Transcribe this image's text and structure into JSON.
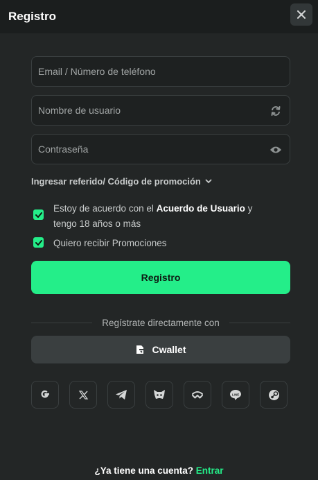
{
  "header": {
    "title": "Registro"
  },
  "form": {
    "email_placeholder": "Email / Número de teléfono",
    "username_placeholder": "Nombre de usuario",
    "password_placeholder": "Contraseña",
    "referral_label": "Ingresar referido/ Código de promoción"
  },
  "agreements": {
    "terms_prefix": "Estoy de acuerdo con el ",
    "terms_link": "Acuerdo de Usuario",
    "terms_suffix": " y tengo 18 años o más",
    "promos": "Quiero recibir Promociones"
  },
  "actions": {
    "register_label": "Registro",
    "divider_label": "Regístrate directamente con",
    "cwallet_label": "Cwallet"
  },
  "socials": [
    "google-icon",
    "x-icon",
    "telegram-icon",
    "metamask-icon",
    "walletconnect-icon",
    "line-icon",
    "steam-icon"
  ],
  "footer": {
    "question": "¿Ya tiene una cuenta?",
    "login_link": "Entrar"
  },
  "colors": {
    "accent": "#24ee89",
    "background": "#232626",
    "header": "#1b1e1e"
  }
}
